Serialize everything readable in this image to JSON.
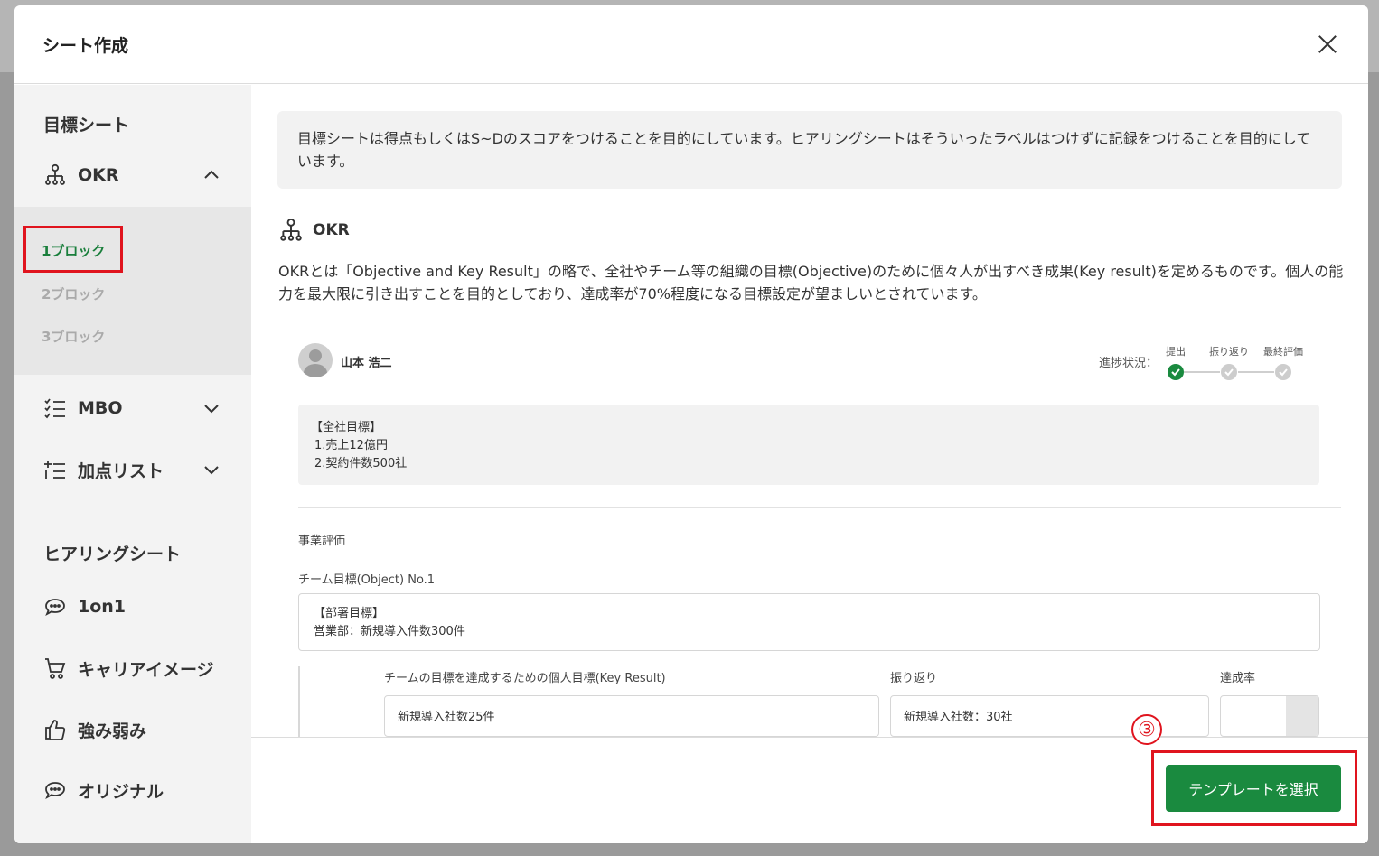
{
  "modal": {
    "title": "シート作成"
  },
  "sidebar": {
    "section_goal": "目標シート",
    "okr_label": "OKR",
    "okr_sub": [
      "1ブロック",
      "2ブロック",
      "3ブロック"
    ],
    "mbo_label": "MBO",
    "katen_label": "加点リスト",
    "section_hearing": "ヒアリングシート",
    "hearing_items": [
      "1on1",
      "キャリアイメージ",
      "強み弱み",
      "オリジナル"
    ]
  },
  "content": {
    "info": "目標シートは得点もしくはS~Dのスコアをつけることを目的にしています。ヒアリングシートはそういったラベルはつけずに記録をつけることを目的にしています。",
    "okr_title": "OKR",
    "okr_desc": "OKRとは「Objective and Key Result」の略で、全社やチーム等の組織の目標(Objective)のために個々人が出すべき成果(Key result)を定めるものです。個人の能力を最大限に引き出すことを目的としており、達成率が70%程度になる目標設定が望ましいとされています。"
  },
  "preview": {
    "user_name": "山本 浩二",
    "progress_label": "進捗状況：",
    "steps": [
      "提出",
      "振り返り",
      "最終評価"
    ],
    "company_goal_title": "【全社目標】",
    "company_goal_lines": [
      "1.売上12億円",
      "2.契約件数500社"
    ],
    "biz_label": "事業評価",
    "team_label": "チーム目標(Object) No.1",
    "dept_title": "【部署目標】",
    "dept_value": "営業部：新規導入件数300件",
    "col_keyresult": "チームの目標を達成するための個人目標(Key Result)",
    "col_review": "振り返り",
    "col_rate": "達成率",
    "field_keyresult": "新規導入社数25件",
    "field_review": "新規導入社数：30社"
  },
  "footer": {
    "select_label": "テンプレートを選択",
    "step_marker": "③"
  },
  "colors": {
    "accent": "#1a8a3f",
    "highlight": "#e0141e"
  }
}
